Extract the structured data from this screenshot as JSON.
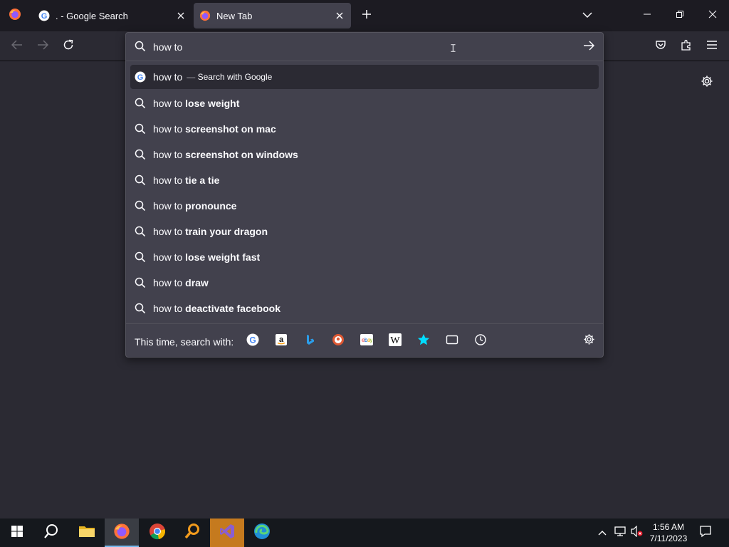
{
  "tabs": [
    {
      "title": ". - Google Search",
      "favicon": "google-icon"
    },
    {
      "title": "New Tab",
      "favicon": "firefox-icon"
    }
  ],
  "urlbar": {
    "value": "how to",
    "go_icon": "arrow-right-icon"
  },
  "suggestions": {
    "first": {
      "base": "how to",
      "dash": "—",
      "action": "Search with Google"
    },
    "items": [
      {
        "base": "how to ",
        "bold": "lose weight"
      },
      {
        "base": "how to ",
        "bold": "screenshot on mac"
      },
      {
        "base": "how to ",
        "bold": "screenshot on windows"
      },
      {
        "base": "how to ",
        "bold": "tie a tie"
      },
      {
        "base": "how to ",
        "bold": "pronounce"
      },
      {
        "base": "how to ",
        "bold": "train your dragon"
      },
      {
        "base": "how to ",
        "bold": "lose weight fast"
      },
      {
        "base": "how to ",
        "bold": "draw"
      },
      {
        "base": "how to ",
        "bold": "deactivate facebook"
      }
    ]
  },
  "oneoff": {
    "label": "This time, search with:",
    "engines": [
      "google-icon",
      "amazon-icon",
      "bing-icon",
      "duckduckgo-icon",
      "ebay-icon",
      "wikipedia-icon",
      "bookmarks-icon",
      "tabs-icon",
      "history-icon"
    ]
  },
  "taskbar": {
    "time": "1:56 AM",
    "date": "7/11/2023"
  },
  "colors": {
    "toolbar": "#2b2a33",
    "tabstrip": "#1c1b22",
    "popup": "#42414d",
    "accent": "#00ddff"
  }
}
